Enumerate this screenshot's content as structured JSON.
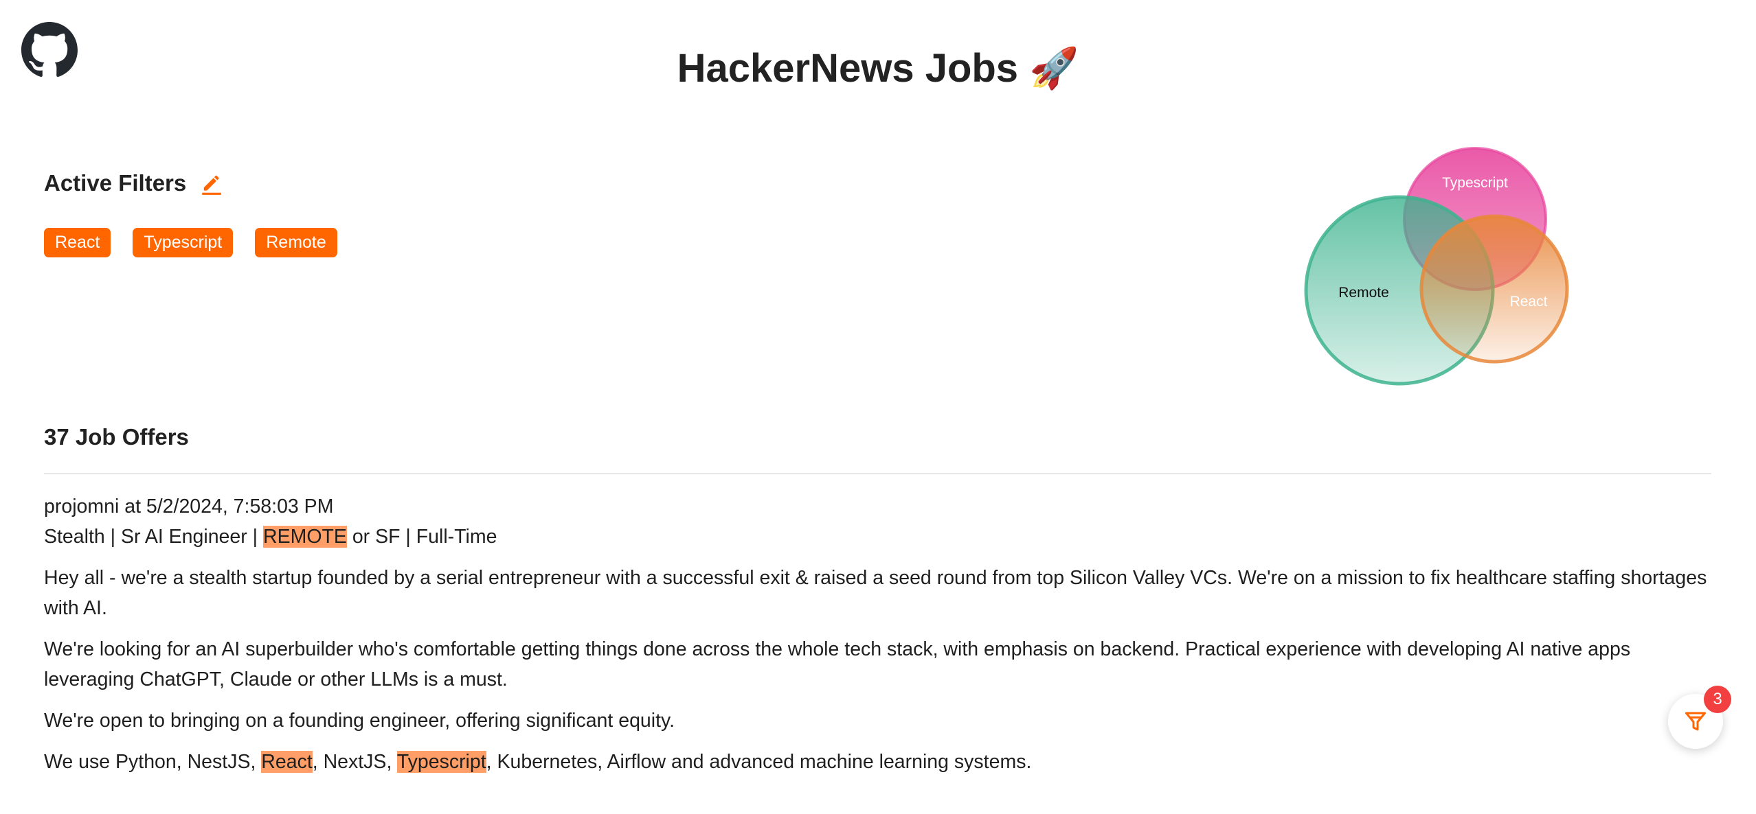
{
  "header": {
    "title": "HackerNews Jobs 🚀",
    "github_icon": "github-icon"
  },
  "filters": {
    "title": "Active Filters",
    "edit_icon": "pencil-icon",
    "tags": [
      "React",
      "Typescript",
      "Remote"
    ]
  },
  "venn": {
    "sets": [
      {
        "label": "Typescript",
        "color": "#e8489f"
      },
      {
        "label": "Remote",
        "color": "#3db38e"
      },
      {
        "label": "React",
        "color": "#e8873a"
      }
    ]
  },
  "results": {
    "count_label": "37 Job Offers"
  },
  "job": {
    "meta": "projomni at 5/2/2024, 7:58:03 PM",
    "subject": {
      "before": "Stealth | Sr AI Engineer | ",
      "highlight": "REMOTE",
      "after": " or SF | Full-Time"
    },
    "paragraph_1": "Hey all - we're a stealth startup founded by a serial entrepreneur with a successful exit & raised a seed round from top Silicon Valley VCs. We're on a mission to fix healthcare staffing shortages with AI.",
    "paragraph_2": "We're looking for an AI superbuilder who's comfortable getting things done across the whole tech stack, with emphasis on backend. Practical experience with developing AI native apps leveraging ChatGPT, Claude or other LLMs is a must.",
    "paragraph_3": "We're open to bringing on a founding engineer, offering significant equity.",
    "stack": {
      "part_1": "We use Python, NestJS, ",
      "highlight_1": "React",
      "part_2": ", NextJS, ",
      "highlight_2": "Typescript",
      "part_3": ", Kubernetes, Airflow and advanced machine learning systems."
    }
  },
  "fab": {
    "icon": "filter-icon",
    "badge_count": "3",
    "accent": "#ff6600",
    "badge_color": "#f23f3f"
  },
  "colors": {
    "accent": "#ff6600",
    "highlight": "#ff9e66"
  }
}
